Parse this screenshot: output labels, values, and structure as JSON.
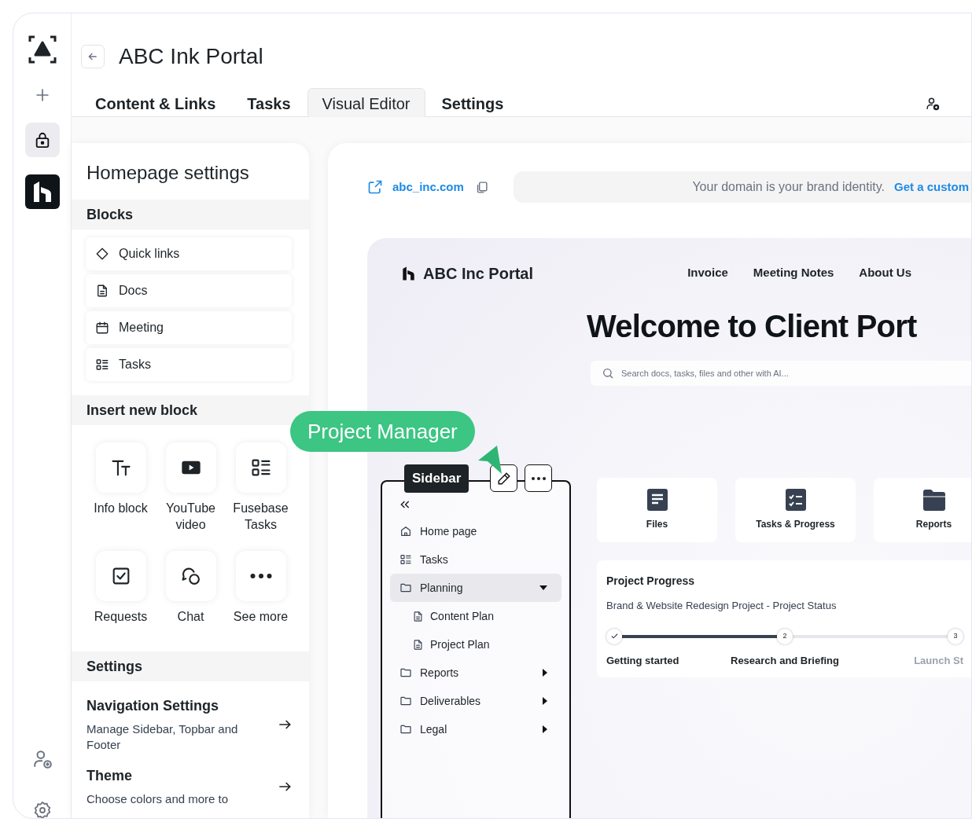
{
  "rail": {
    "items": [
      {
        "kind": "lock",
        "selected": true
      },
      {
        "kind": "app",
        "selected": false
      }
    ]
  },
  "header": {
    "title": "ABC Ink Portal"
  },
  "tabs": [
    {
      "label": "Content & Links",
      "selected": false
    },
    {
      "label": "Tasks",
      "selected": false
    },
    {
      "label": "Visual Editor",
      "selected": true
    },
    {
      "label": "Settings",
      "selected": false
    }
  ],
  "homepage_settings": {
    "title": "Homepage settings",
    "blocks_heading": "Blocks",
    "blocks": [
      {
        "kind": "diamond",
        "label": "Quick links"
      },
      {
        "kind": "doc",
        "label": "Docs"
      },
      {
        "kind": "calendar",
        "label": "Meeting"
      },
      {
        "kind": "tasks",
        "label": "Tasks"
      }
    ],
    "insert_heading": "Insert new block",
    "insert_blocks": [
      {
        "kind": "text",
        "label": "Info block"
      },
      {
        "kind": "youtube",
        "label": "YouTube video"
      },
      {
        "kind": "tasks",
        "label": "Fusebase Tasks"
      },
      {
        "kind": "checkbox",
        "label": "Requests"
      },
      {
        "kind": "chat",
        "label": "Chat"
      },
      {
        "kind": "more",
        "label": "See more"
      }
    ],
    "settings_heading": "Settings",
    "settings": [
      {
        "title": "Navigation Settings",
        "description": "Manage Sidebar, Topbar and Footer"
      },
      {
        "title": "Theme",
        "description": "Choose colors and more to"
      }
    ]
  },
  "preview": {
    "domain": "abc_inc.com",
    "banner_text": "Your domain is your brand identity.",
    "banner_link": "Get a custom",
    "site": {
      "name": "ABC Inc Portal",
      "nav": [
        "Invoice",
        "Meeting Notes",
        "About Us"
      ],
      "heading": "Welcome to Client Port",
      "search_placeholder": "Search docs, tasks, files and other with AI...",
      "sidebar": {
        "label": "Sidebar",
        "items": [
          {
            "kind": "home",
            "label": "Home page",
            "selected": false
          },
          {
            "kind": "tasks",
            "label": "Tasks",
            "selected": false
          },
          {
            "kind": "folder",
            "label": "Planning",
            "selected": true,
            "expanded": true,
            "children": [
              {
                "kind": "doc",
                "label": "Content Plan",
                "selected": false
              },
              {
                "kind": "doc",
                "label": "Project Plan",
                "selected": false
              }
            ]
          },
          {
            "kind": "folder",
            "label": "Reports",
            "selected": false,
            "expanded": false
          },
          {
            "kind": "folder",
            "label": "Deliverables",
            "selected": false,
            "expanded": false
          },
          {
            "kind": "folder",
            "label": "Legal",
            "selected": false,
            "expanded": false
          }
        ]
      },
      "cards": [
        {
          "kind": "files",
          "label": "Files"
        },
        {
          "kind": "checklist",
          "label": "Tasks & Progress"
        },
        {
          "kind": "folder",
          "label": "Reports"
        }
      ],
      "progress": {
        "title": "Project Progress",
        "subtitle": "Brand & Website Redesign Project - Project Status",
        "steps": [
          {
            "label": "Getting started",
            "done": true,
            "reached": true
          },
          {
            "number": "2",
            "label": "Research and Briefing",
            "done": false,
            "reached": true
          },
          {
            "number": "3",
            "label": "Launch St",
            "done": false,
            "reached": false
          }
        ]
      }
    }
  },
  "badge": "Project Manager"
}
